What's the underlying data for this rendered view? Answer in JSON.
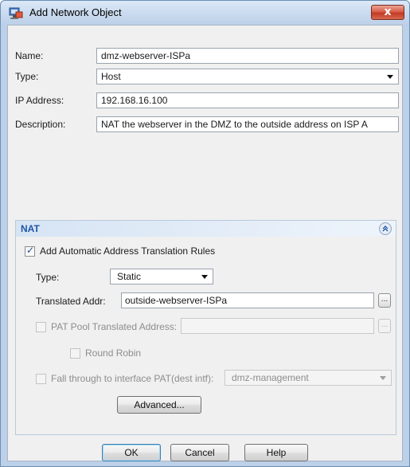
{
  "window": {
    "title": "Add Network Object",
    "close_label": "x"
  },
  "form": {
    "name_label": "Name:",
    "name_value": "dmz-webserver-ISPa",
    "type_label": "Type:",
    "type_value": "Host",
    "ip_label": "IP Address:",
    "ip_value": "192.168.16.100",
    "description_label": "Description:",
    "description_value": "NAT the webserver in the DMZ to the outside address on ISP A"
  },
  "nat": {
    "title": "NAT",
    "collapse_icon": "double-chevron-up-icon",
    "auto_rules_label": "Add Automatic Address Translation Rules",
    "auto_rules_checked": true,
    "type_label": "Type:",
    "type_value": "Static",
    "translated_label": "Translated Addr:",
    "translated_value": "outside-webserver-ISPa",
    "pat_pool_label": "PAT Pool Translated Address:",
    "round_robin_label": "Round Robin",
    "fall_through_label": "Fall through to interface PAT(dest intf):",
    "fall_through_value": "dmz-management",
    "advanced_label": "Advanced...",
    "ellipsis_label": "..."
  },
  "buttons": {
    "ok": "OK",
    "cancel": "Cancel",
    "help": "Help"
  },
  "colors": {
    "nat_title": "#1f56a8",
    "close_button": "#c23a24"
  }
}
